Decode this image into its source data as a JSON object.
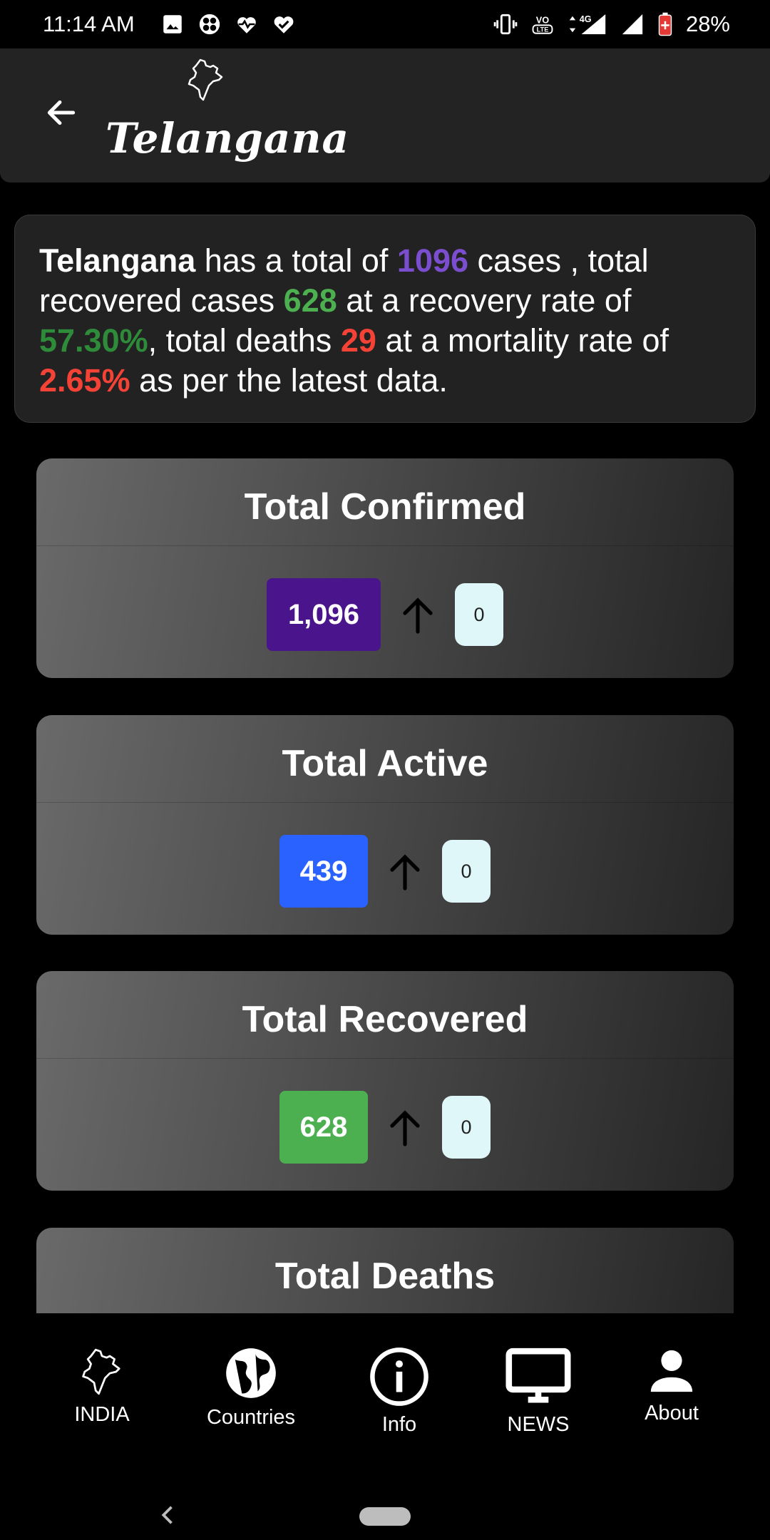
{
  "status_bar": {
    "time": "11:14 AM",
    "battery": "28%",
    "network": "4G",
    "volte": "VoLTE",
    "left_icons": [
      "gallery-icon",
      "pinwheel-icon",
      "heartbeat-icon",
      "heart-check-icon"
    ],
    "right_icons": [
      "vibrate-icon",
      "volte-icon",
      "signal-4g-icon",
      "signal-icon",
      "battery-icon"
    ]
  },
  "header": {
    "title": "Telangana",
    "back_icon": "arrow-left-icon",
    "map_icon": "india-map-icon"
  },
  "summary": {
    "state": "Telangana",
    "t1": " has a total of ",
    "total_cases": "1096",
    "t2": " cases , total recovered cases ",
    "recovered": "628",
    "t3": " at a recovery rate of ",
    "recovery_rate": "57.30%",
    "t4": ", total deaths ",
    "deaths": "29",
    "t5": " at a mortality rate of ",
    "mortality_rate": "2.65%",
    "t6": " as per the latest data."
  },
  "cards": [
    {
      "title": "Total Confirmed",
      "value": "1,096",
      "delta": "0",
      "color": "#4a148c"
    },
    {
      "title": "Total Active",
      "value": "439",
      "delta": "0",
      "color": "#2962ff"
    },
    {
      "title": "Total Recovered",
      "value": "628",
      "delta": "0",
      "color": "#4caf50"
    },
    {
      "title": "Total Deaths"
    }
  ],
  "bottom_nav": {
    "items": [
      {
        "label": "INDIA",
        "icon": "india-map-icon"
      },
      {
        "label": "Countries",
        "icon": "globe-icon"
      },
      {
        "label": "Info",
        "icon": "info-icon"
      },
      {
        "label": "NEWS",
        "icon": "tv-icon"
      },
      {
        "label": "About",
        "icon": "person-icon"
      }
    ]
  },
  "colors": {
    "confirmed": "#4a148c",
    "active": "#2962ff",
    "recovered": "#4caf50",
    "purple_text": "#7b4ed0",
    "red_text": "#f44336",
    "delta_badge": "#e0f7fa"
  }
}
